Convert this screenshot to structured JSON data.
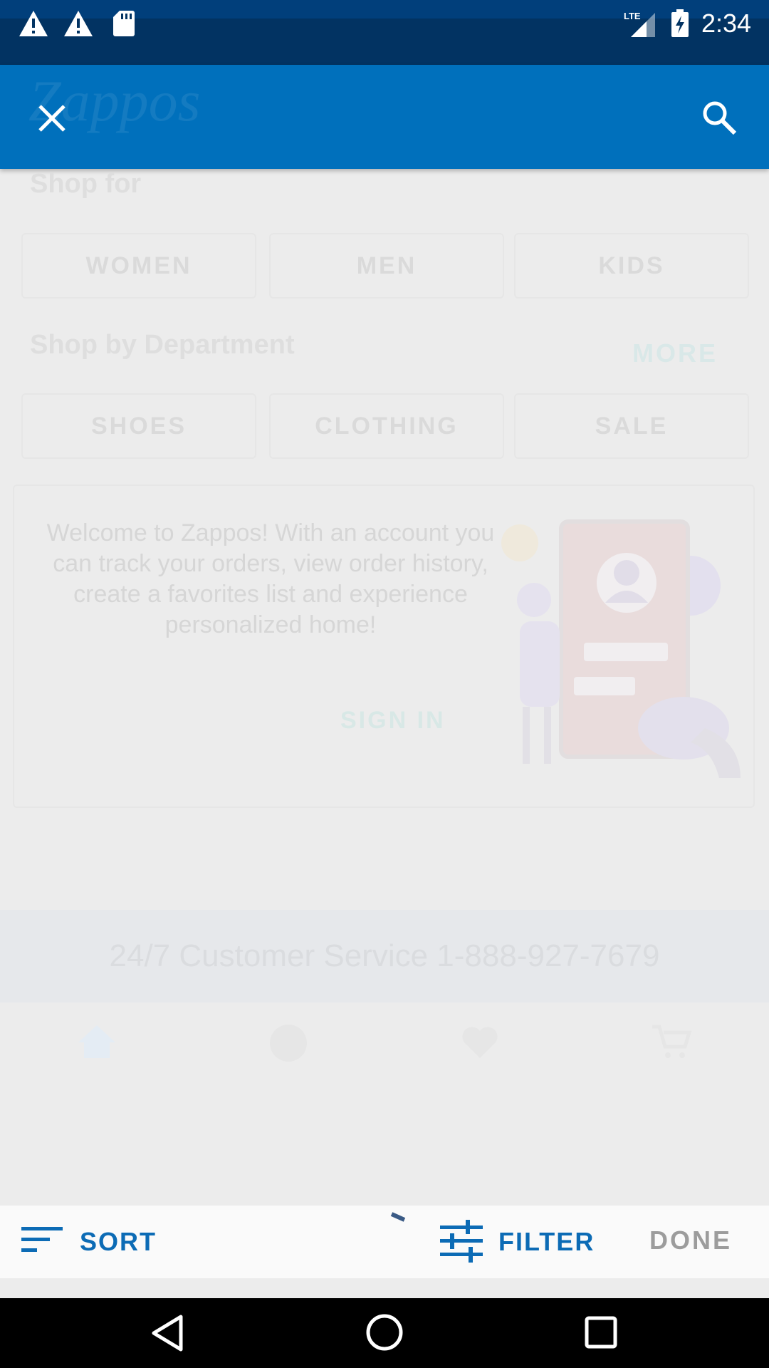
{
  "status_bar": {
    "time": "2:34",
    "network": "LTE",
    "icons": [
      "warning-icon",
      "warning-icon",
      "sd-card-icon",
      "lte-signal-icon",
      "battery-charging-icon"
    ]
  },
  "toolbar": {
    "logo_text": "Zappos",
    "close_icon": "close-icon",
    "search_icon": "search-icon",
    "background_color": "#0070bc"
  },
  "background": {
    "shop_for_title": "Shop for",
    "shop_for_items": [
      "WOMEN",
      "MEN",
      "KIDS"
    ],
    "department_title": "Shop by Department",
    "more_label": "MORE",
    "department_items": [
      "SHOES",
      "CLOTHING",
      "SALE"
    ],
    "welcome_text": "Welcome to Zappos! With an account you can track your orders, view order history, create a favorites list and experience personalized home!",
    "sign_in_label": "SIGN IN",
    "customer_service": "24/7 Customer Service 1-888-927-7679",
    "nav_labels": [
      "Home",
      "My Account",
      "Favorites",
      "Cart"
    ]
  },
  "action_bar": {
    "sort_label": "SORT",
    "filter_label": "FILTER",
    "done_label": "DONE",
    "accent_color": "#0c6bb5"
  },
  "system_nav": {
    "icons": [
      "back-icon",
      "home-icon",
      "recents-icon"
    ]
  }
}
